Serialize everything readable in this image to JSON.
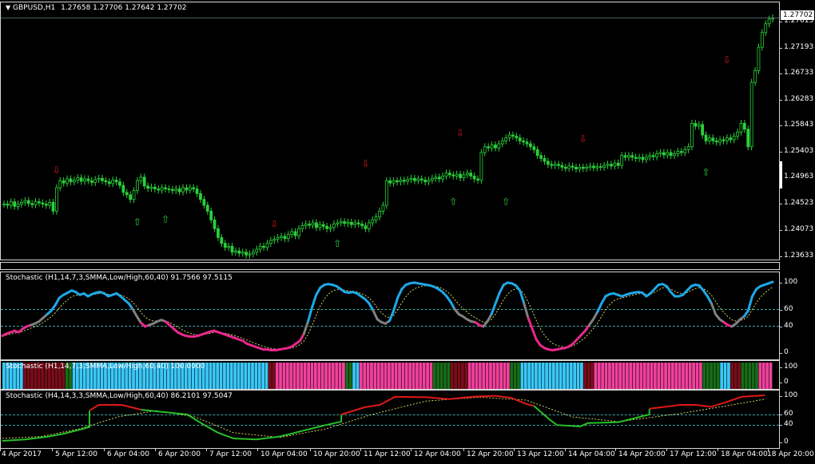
{
  "main": {
    "symbol_label": "GBPUSD,H1",
    "ohlc_label": "1.27658 1.27706 1.27642 1.27702",
    "current_price": "1.27702",
    "price_ticks": [
      "1.27702",
      "1.27613",
      "1.27193",
      "1.26733",
      "1.26283",
      "1.25843",
      "1.25403",
      "1.24963",
      "1.24523",
      "1.24073",
      "1.23633"
    ],
    "colors": {
      "bull": "#2ad03a",
      "bear": "#2ad03a",
      "up_arrow": "#2ad03a",
      "down_arrow": "#d01818",
      "background": "#000000"
    }
  },
  "stoch1": {
    "label": "Stochastic (H1,14,7,3,SMMA,Low/High,60,40) 91.7566 97.5115",
    "ticks": [
      "100",
      "60",
      "40",
      "0"
    ],
    "levels": [
      60,
      40
    ],
    "colors": {
      "up": "#1ea8e8",
      "down": "#e8288c",
      "neutral": "#808080",
      "signal": "#ffff80"
    }
  },
  "stoch_bar": {
    "label": "Stochastic (H1,14,7,3,SMMA,Low/High,60,40) 100.0000",
    "ticks": [
      "100",
      "0"
    ],
    "colors": {
      "up": "#3ac8f8",
      "down": "#f0409c",
      "green": "#186c18",
      "maroon": "#7a0c1a"
    }
  },
  "stoch2": {
    "label": "Stochastic (H4,14,3,3,SMMA,Low/High,60,40) 86.2101 97.5047",
    "ticks": [
      "100",
      "60",
      "40",
      "0"
    ],
    "colors": {
      "up": "#e01818",
      "down": "#28c028",
      "neutral": "#808080",
      "signal": "#ffff80"
    }
  },
  "time_axis": [
    "4 Apr 2017",
    "5 Apr 12:00",
    "6 Apr 04:00",
    "6 Apr 20:00",
    "7 Apr 12:00",
    "10 Apr 04:00",
    "10 Apr 20:00",
    "11 Apr 12:00",
    "12 Apr 04:00",
    "12 Apr 20:00",
    "13 Apr 12:00",
    "14 Apr 04:00",
    "14 Apr 20:00",
    "17 Apr 12:00",
    "18 Apr 04:00",
    "18 Apr 20:00"
  ],
  "series": {
    "price_close": [
      1.2452,
      1.245,
      1.2456,
      1.2448,
      1.2452,
      1.2455,
      1.2458,
      1.2453,
      1.2451,
      1.2456,
      1.2454,
      1.2452,
      1.245,
      1.2455,
      1.244,
      1.248,
      1.2492,
      1.2488,
      1.2495,
      1.249,
      1.2493,
      1.2497,
      1.2491,
      1.2495,
      1.2492,
      1.2489,
      1.2494,
      1.2496,
      1.2492,
      1.249,
      1.2487,
      1.2493,
      1.249,
      1.2484,
      1.2472,
      1.2468,
      1.246,
      1.2475,
      1.2492,
      1.2498,
      1.2483,
      1.2479,
      1.2481,
      1.2478,
      1.2476,
      1.248,
      1.2478,
      1.2477,
      1.2475,
      1.2478,
      1.2473,
      1.248,
      1.2476,
      1.248,
      1.2478,
      1.247,
      1.246,
      1.245,
      1.244,
      1.2425,
      1.241,
      1.2395,
      1.2385,
      1.2378,
      1.238,
      1.237,
      1.2372,
      1.2368,
      1.237,
      1.2365,
      1.2367,
      1.237,
      1.2375,
      1.238,
      1.2378,
      1.2385,
      1.239,
      1.2392,
      1.2395,
      1.2397,
      1.2393,
      1.24,
      1.2405,
      1.2398,
      1.241,
      1.2415,
      1.2418,
      1.2416,
      1.242,
      1.2412,
      1.2417,
      1.2414,
      1.241,
      1.2412,
      1.2418,
      1.242,
      1.2422,
      1.2419,
      1.2421,
      1.2417,
      1.242,
      1.2418,
      1.2415,
      1.241,
      1.242,
      1.2425,
      1.243,
      1.244,
      1.245,
      1.2492,
      1.2488,
      1.2492,
      1.249,
      1.2493,
      1.2491,
      1.2494,
      1.2496,
      1.2492,
      1.2495,
      1.2493,
      1.249,
      1.2493,
      1.2496,
      1.2498,
      1.2495,
      1.25,
      1.2505,
      1.2502,
      1.25,
      1.2503,
      1.2497,
      1.2502,
      1.2505,
      1.25,
      1.2495,
      1.2493,
      1.254,
      1.255,
      1.2548,
      1.2553,
      1.2548,
      1.2555,
      1.256,
      1.2565,
      1.257,
      1.2568,
      1.2565,
      1.256,
      1.2558,
      1.2555,
      1.255,
      1.2545,
      1.2535,
      1.253,
      1.2525,
      1.252,
      1.2518,
      1.252,
      1.2518,
      1.2515,
      1.2513,
      1.2517,
      1.2515,
      1.2512,
      1.2515,
      1.2513,
      1.2515,
      1.2517,
      1.2514,
      1.2516,
      1.2515,
      1.2518,
      1.252,
      1.2517,
      1.2522,
      1.2518,
      1.2535,
      1.2532,
      1.2535,
      1.2532,
      1.253,
      1.2532,
      1.2528,
      1.2532,
      1.2535,
      1.2533,
      1.2538,
      1.254,
      1.2536,
      1.254,
      1.2535,
      1.2538,
      1.2542,
      1.254,
      1.2545,
      1.255,
      1.259,
      1.2585,
      1.2588,
      1.257,
      1.256,
      1.2565,
      1.256,
      1.2558,
      1.2562,
      1.256,
      1.2565,
      1.2562,
      1.2568,
      1.2575,
      1.259,
      1.258,
      1.255,
      1.266,
      1.268,
      1.272,
      1.2745,
      1.276,
      1.2768,
      1.277
    ],
    "stoch1": [
      25,
      28,
      30,
      32,
      30,
      35,
      38,
      40,
      42,
      45,
      50,
      55,
      60,
      68,
      78,
      82,
      85,
      88,
      86,
      82,
      84,
      80,
      83,
      85,
      86,
      84,
      80,
      82,
      84,
      80,
      75,
      70,
      62,
      52,
      43,
      38,
      40,
      42,
      45,
      47,
      45,
      40,
      35,
      30,
      27,
      25,
      24,
      24,
      25,
      27,
      29,
      31,
      32,
      30,
      28,
      26,
      24,
      22,
      20,
      18,
      14,
      12,
      10,
      8,
      6,
      6,
      5,
      5,
      6,
      7,
      8,
      10,
      14,
      18,
      28,
      45,
      65,
      82,
      92,
      96,
      97,
      96,
      94,
      90,
      86,
      85,
      86,
      84,
      80,
      76,
      70,
      60,
      48,
      44,
      42,
      46,
      60,
      78,
      90,
      96,
      98,
      99,
      98,
      97,
      96,
      95,
      93,
      90,
      86,
      80,
      72,
      62,
      55,
      52,
      48,
      45,
      44,
      40,
      38,
      45,
      55,
      70,
      85,
      96,
      99,
      98,
      95,
      88,
      70,
      50,
      35,
      20,
      12,
      8,
      6,
      5,
      6,
      7,
      8,
      10,
      14,
      20,
      26,
      32,
      40,
      48,
      58,
      70,
      80,
      83,
      84,
      82,
      80,
      82,
      84,
      85,
      86,
      85,
      80,
      84,
      90,
      96,
      97,
      94,
      86,
      80,
      80,
      82,
      88,
      94,
      96,
      95,
      88,
      80,
      70,
      55,
      48,
      44,
      40,
      38,
      42,
      48,
      52,
      60,
      80,
      90,
      94,
      96,
      98,
      100
    ],
    "stoch1_colorblocks": [
      "#1ea8e8",
      "#e8288c",
      "#808080"
    ],
    "bar_blocks": [
      {
        "from": 0,
        "to": 6,
        "color": "#3ac8f8"
      },
      {
        "from": 6,
        "to": 18,
        "color": "#7a0c1a"
      },
      {
        "from": 18,
        "to": 20,
        "color": "#186c18"
      },
      {
        "from": 20,
        "to": 76,
        "color": "#3ac8f8"
      },
      {
        "from": 76,
        "to": 78,
        "color": "#7a0c1a"
      },
      {
        "from": 78,
        "to": 98,
        "color": "#f0409c"
      },
      {
        "from": 98,
        "to": 100,
        "color": "#186c18"
      },
      {
        "from": 100,
        "to": 102,
        "color": "#3ac8f8"
      },
      {
        "from": 102,
        "to": 105,
        "color": "#f0409c"
      },
      {
        "from": 105,
        "to": 123,
        "color": "#f0409c"
      },
      {
        "from": 123,
        "to": 128,
        "color": "#186c18"
      },
      {
        "from": 128,
        "to": 133,
        "color": "#7a0c1a"
      },
      {
        "from": 133,
        "to": 145,
        "color": "#f0409c"
      },
      {
        "from": 145,
        "to": 148,
        "color": "#186c18"
      },
      {
        "from": 148,
        "to": 166,
        "color": "#3ac8f8"
      },
      {
        "from": 166,
        "to": 169,
        "color": "#7a0c1a"
      },
      {
        "from": 169,
        "to": 200,
        "color": "#f0409c"
      },
      {
        "from": 200,
        "to": 205,
        "color": "#186c18"
      },
      {
        "from": 205,
        "to": 208,
        "color": "#3ac8f8"
      },
      {
        "from": 208,
        "to": 211,
        "color": "#7a0c1a"
      },
      {
        "from": 211,
        "to": 216,
        "color": "#186c18"
      },
      {
        "from": 216,
        "to": 220,
        "color": "#f0409c"
      }
    ],
    "stoch2_red": [
      {
        "from": [
          0.113,
          0.72
        ],
        "pts": [
          [
            0.113,
            68
          ],
          [
            0.125,
            80
          ],
          [
            0.155,
            80
          ],
          [
            0.18,
            70
          ]
        ]
      },
      {
        "from": [
          0.44,
          60
        ],
        "pts": [
          [
            0.44,
            60
          ],
          [
            0.47,
            75
          ],
          [
            0.49,
            80
          ],
          [
            0.51,
            97
          ],
          [
            0.55,
            96
          ],
          [
            0.58,
            92
          ],
          [
            0.61,
            97
          ],
          [
            0.64,
            99
          ],
          [
            0.66,
            95
          ],
          [
            0.68,
            82
          ],
          [
            0.69,
            78
          ]
        ]
      },
      {
        "from": [
          0.84,
          72
        ],
        "pts": [
          [
            0.84,
            72
          ],
          [
            0.87,
            78
          ],
          [
            0.88,
            80
          ],
          [
            0.9,
            80
          ],
          [
            0.92,
            76
          ],
          [
            0.94,
            86
          ],
          [
            0.96,
            97
          ],
          [
            0.99,
            100
          ]
        ]
      }
    ]
  },
  "signals": [
    {
      "type": "up",
      "price": 1.2435,
      "index": 38
    },
    {
      "type": "up",
      "price": 1.244,
      "index": 46
    },
    {
      "type": "up",
      "price": 1.2398,
      "index": 95
    },
    {
      "type": "up",
      "price": 1.247,
      "index": 128
    },
    {
      "type": "up",
      "price": 1.247,
      "index": 143
    },
    {
      "type": "up",
      "price": 1.252,
      "index": 200
    },
    {
      "type": "down",
      "price": 1.2502,
      "index": 15
    },
    {
      "type": "down",
      "price": 1.241,
      "index": 77
    },
    {
      "type": "down",
      "price": 1.2513,
      "index": 103
    },
    {
      "type": "down",
      "price": 1.2565,
      "index": 130
    },
    {
      "type": "down",
      "price": 1.2555,
      "index": 165
    },
    {
      "type": "down",
      "price": 1.269,
      "index": 206
    }
  ]
}
